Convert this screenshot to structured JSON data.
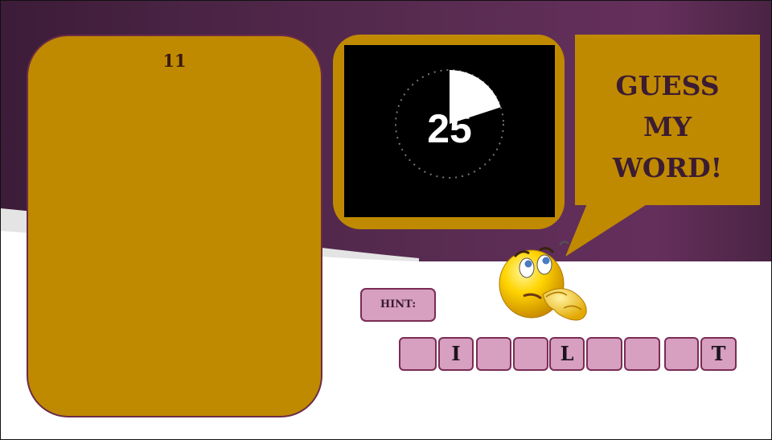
{
  "game": {
    "count": "11",
    "timer": {
      "seconds": "25",
      "remaining_fraction": 0.2
    },
    "speech": {
      "line1": "GUESS",
      "line2": "MY",
      "line3": "WORD!"
    },
    "hint_label": "HINT:",
    "tiles": [
      "",
      "I",
      "",
      "",
      "L",
      "",
      "",
      "",
      "T"
    ]
  },
  "colors": {
    "banner": "#4a2444",
    "panel": "#c08a00",
    "tile": "#d79fc0",
    "tile_border": "#7b2c55",
    "text_dark": "#3b1c32"
  },
  "icons": {
    "mascot": "thinking-face-icon",
    "timer": "countdown-pie-icon"
  }
}
